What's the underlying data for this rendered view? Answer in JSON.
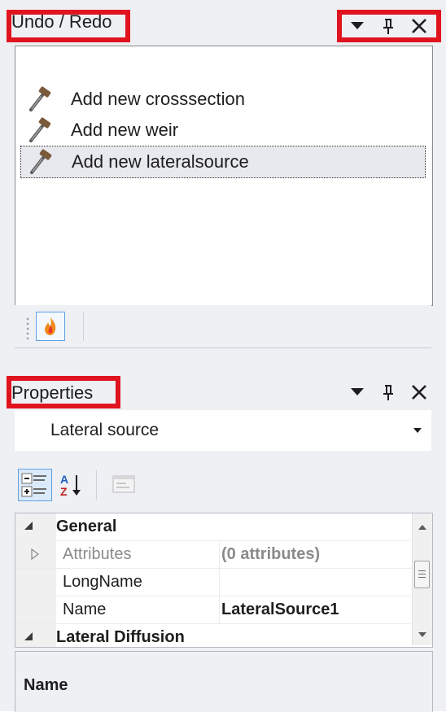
{
  "undo_panel": {
    "title": "Undo / Redo",
    "items": [
      {
        "label": "Add new crosssection",
        "icon": "gavel-icon",
        "selected": false
      },
      {
        "label": "Add new weir",
        "icon": "gavel-icon",
        "selected": false
      },
      {
        "label": "Add new lateralsource",
        "icon": "gavel-icon",
        "selected": true
      }
    ],
    "toolbar": {
      "button_icon": "flame-icon"
    }
  },
  "properties_panel": {
    "title": "Properties",
    "object_selector": {
      "value": "Lateral source"
    },
    "toolbar": [
      "categorized-icon",
      "alphabetical-sort-icon",
      "property-pages-icon"
    ],
    "grid": {
      "category": "General",
      "rows": [
        {
          "name": "Attributes",
          "value": "(0 attributes)",
          "expandable": true,
          "readonly": true
        },
        {
          "name": "LongName",
          "value": ""
        },
        {
          "name": "Name",
          "value": "LateralSource1"
        }
      ],
      "next_category_partial": "Lateral Diffusion"
    },
    "description_title": "Name"
  },
  "colors": {
    "highlight": "#e0141e",
    "panel_bg": "#eef0f4",
    "selection": "#e7e9ee",
    "accent": "#5ea0e0"
  }
}
